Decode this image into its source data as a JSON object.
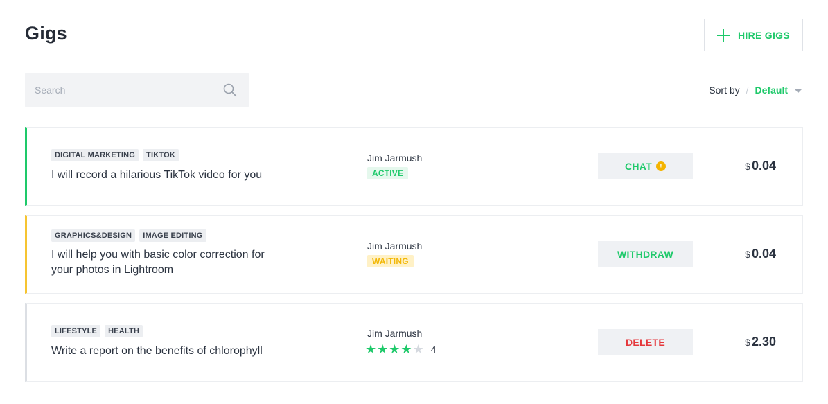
{
  "page": {
    "title": "Gigs"
  },
  "header": {
    "hire_label": "HIRE GIGS"
  },
  "search": {
    "placeholder": "Search",
    "value": ""
  },
  "sort": {
    "label": "Sort by",
    "separator": "/",
    "value": "Default"
  },
  "colors": {
    "accent": "#1ec96a",
    "active_border": "#1ec96a",
    "waiting_border": "#f6c431",
    "neutral_border": "#dcdfe4",
    "delete_text": "#e5373b",
    "warning_dot": "#f4b400"
  },
  "gigs": [
    {
      "tags": [
        "DIGITAL MARKETING",
        "TIKTOK"
      ],
      "title": "I will record a hilarious TikTok video for you",
      "owner": "Jim Jarmush",
      "status": "ACTIVE",
      "action": "CHAT",
      "action_icon": "alert-dot-icon",
      "alert_mark": "!",
      "currency": "$",
      "amount": "0.04"
    },
    {
      "tags": [
        "GRAPHICS&DESIGN",
        "IMAGE EDITING"
      ],
      "title": "I will help you with basic color correction for your photos in Lightroom",
      "owner": "Jim Jarmush",
      "status": "WAITING",
      "action": "WITHDRAW",
      "currency": "$",
      "amount": "0.04"
    },
    {
      "tags": [
        "LIFESTYLE",
        "HEALTH"
      ],
      "title": "Write a report on the benefits of chlorophyll",
      "owner": "Jim Jarmush",
      "rating": 4,
      "rating_max": 5,
      "rating_label": "4",
      "action": "DELETE",
      "currency": "$",
      "amount": "2.30"
    }
  ]
}
